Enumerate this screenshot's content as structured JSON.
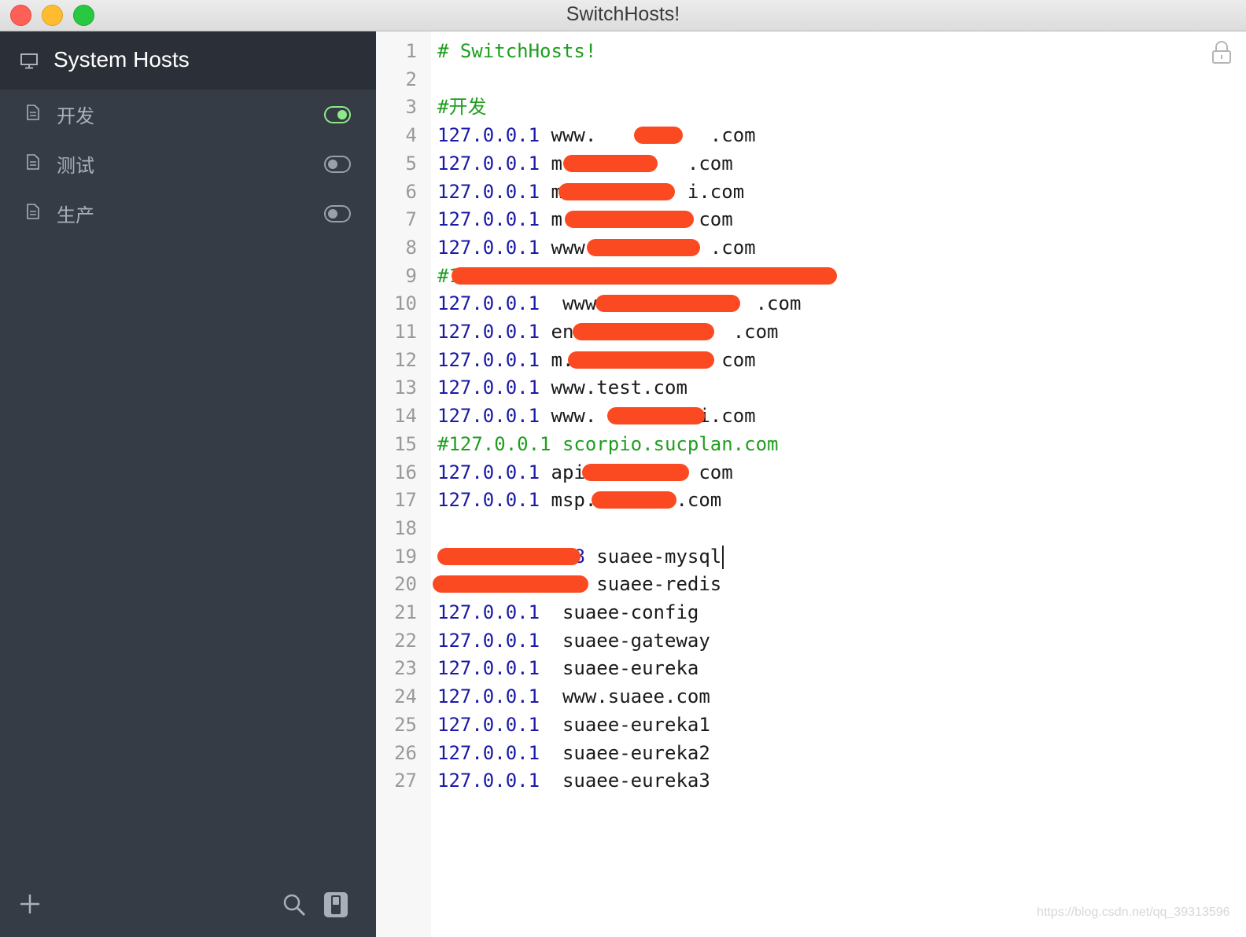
{
  "window": {
    "title": "SwitchHosts!"
  },
  "sidebar": {
    "system_hosts_label": "System Hosts",
    "items": [
      {
        "label": "开发",
        "enabled": true
      },
      {
        "label": "测试",
        "enabled": false
      },
      {
        "label": "生产",
        "enabled": false
      }
    ],
    "icons": {
      "add": "plus-icon",
      "search": "search-icon",
      "switch": "toggle-panel-icon",
      "doc": "document-icon",
      "monitor": "monitor-icon"
    }
  },
  "editor": {
    "lock_icon": "lock-icon",
    "lines": [
      {
        "n": "1",
        "parts": [
          {
            "t": "# SwitchHosts!",
            "c": "comment"
          }
        ]
      },
      {
        "n": "2",
        "parts": []
      },
      {
        "n": "3",
        "parts": [
          {
            "t": "#开发",
            "c": "comment"
          }
        ]
      },
      {
        "n": "4",
        "parts": [
          {
            "t": "127.0.0.1",
            "c": "ip"
          },
          {
            "t": " www.",
            "c": "host"
          },
          {
            "t": "          ",
            "c": "host"
          },
          {
            "t": ".com",
            "c": "host"
          }
        ]
      },
      {
        "n": "5",
        "parts": [
          {
            "t": "127.0.0.1",
            "c": "ip"
          },
          {
            "t": " m.",
            "c": "host"
          },
          {
            "t": "          ",
            "c": "host"
          },
          {
            "t": ".com",
            "c": "host"
          }
        ]
      },
      {
        "n": "6",
        "parts": [
          {
            "t": "127.0.0.1",
            "c": "ip"
          },
          {
            "t": " m",
            "c": "host"
          },
          {
            "t": "           ",
            "c": "host"
          },
          {
            "t": "i.com",
            "c": "host"
          }
        ]
      },
      {
        "n": "7",
        "parts": [
          {
            "t": "127.0.0.1",
            "c": "ip"
          },
          {
            "t": " m.",
            "c": "host"
          },
          {
            "t": "           ",
            "c": "host"
          },
          {
            "t": "com",
            "c": "host"
          }
        ]
      },
      {
        "n": "8",
        "parts": [
          {
            "t": "127.0.0.1",
            "c": "ip"
          },
          {
            "t": " www.",
            "c": "host"
          },
          {
            "t": "          ",
            "c": "host"
          },
          {
            "t": ".com",
            "c": "host"
          }
        ]
      },
      {
        "n": "9",
        "parts": [
          {
            "t": "#1",
            "c": "comment"
          }
        ]
      },
      {
        "n": "10",
        "parts": [
          {
            "t": "127.0.0.1",
            "c": "ip"
          },
          {
            "t": "  www.",
            "c": "host"
          },
          {
            "t": "             ",
            "c": "host"
          },
          {
            "t": ".com",
            "c": "host"
          }
        ]
      },
      {
        "n": "11",
        "parts": [
          {
            "t": "127.0.0.1",
            "c": "ip"
          },
          {
            "t": " en.",
            "c": "host"
          },
          {
            "t": "             ",
            "c": "host"
          },
          {
            "t": ".com",
            "c": "host"
          }
        ]
      },
      {
        "n": "12",
        "parts": [
          {
            "t": "127.0.0.1",
            "c": "ip"
          },
          {
            "t": " m.",
            "c": "host"
          },
          {
            "t": "             ",
            "c": "host"
          },
          {
            "t": "com",
            "c": "host"
          }
        ]
      },
      {
        "n": "13",
        "parts": [
          {
            "t": "127.0.0.1",
            "c": "ip"
          },
          {
            "t": " www.test.com",
            "c": "host"
          }
        ]
      },
      {
        "n": "14",
        "parts": [
          {
            "t": "127.0.0.1",
            "c": "ip"
          },
          {
            "t": " www.",
            "c": "host"
          },
          {
            "t": "         ",
            "c": "host"
          },
          {
            "t": "i.com",
            "c": "host"
          }
        ]
      },
      {
        "n": "15",
        "parts": [
          {
            "t": "#127.0.0.1 scorpio.sucplan.com",
            "c": "comment"
          }
        ]
      },
      {
        "n": "16",
        "parts": [
          {
            "t": "127.0.0.1",
            "c": "ip"
          },
          {
            "t": " api.",
            "c": "host"
          },
          {
            "t": "         ",
            "c": "host"
          },
          {
            "t": "com",
            "c": "host"
          }
        ]
      },
      {
        "n": "17",
        "parts": [
          {
            "t": "127.0.0.1",
            "c": "ip"
          },
          {
            "t": " msp.",
            "c": "host"
          },
          {
            "t": "       ",
            "c": "host"
          },
          {
            "t": ".com",
            "c": "host"
          }
        ]
      },
      {
        "n": "18",
        "parts": []
      },
      {
        "n": "19",
        "parts": [
          {
            "t": "            8",
            "c": "ip"
          },
          {
            "t": " suaee-mysql",
            "c": "host"
          }
        ],
        "cursor": true
      },
      {
        "n": "20",
        "parts": [
          {
            "t": "             ",
            "c": "ip"
          },
          {
            "t": " suaee-redis",
            "c": "host"
          }
        ]
      },
      {
        "n": "21",
        "parts": [
          {
            "t": "127.0.0.1",
            "c": "ip"
          },
          {
            "t": "  suaee-config",
            "c": "host"
          }
        ]
      },
      {
        "n": "22",
        "parts": [
          {
            "t": "127.0.0.1",
            "c": "ip"
          },
          {
            "t": "  suaee-gateway",
            "c": "host"
          }
        ]
      },
      {
        "n": "23",
        "parts": [
          {
            "t": "127.0.0.1",
            "c": "ip"
          },
          {
            "t": "  suaee-eureka",
            "c": "host"
          }
        ]
      },
      {
        "n": "24",
        "parts": [
          {
            "t": "127.0.0.1",
            "c": "ip"
          },
          {
            "t": "  www.suaee.com",
            "c": "host"
          }
        ]
      },
      {
        "n": "25",
        "parts": [
          {
            "t": "127.0.0.1",
            "c": "ip"
          },
          {
            "t": "  suaee-eureka1",
            "c": "host"
          }
        ]
      },
      {
        "n": "26",
        "parts": [
          {
            "t": "127.0.0.1",
            "c": "ip"
          },
          {
            "t": "  suaee-eureka2",
            "c": "host"
          }
        ]
      },
      {
        "n": "27",
        "parts": [
          {
            "t": "127.0.0.1",
            "c": "ip"
          },
          {
            "t": "  suaee-eureka3",
            "c": "host"
          }
        ]
      }
    ]
  },
  "watermark": "https://blog.csdn.net/qq_39313596",
  "colors": {
    "redaction": "#fb4a22",
    "toggle_on": "#8fe98a",
    "ip": "#1a1aa6",
    "comment": "#1f9e1f"
  }
}
